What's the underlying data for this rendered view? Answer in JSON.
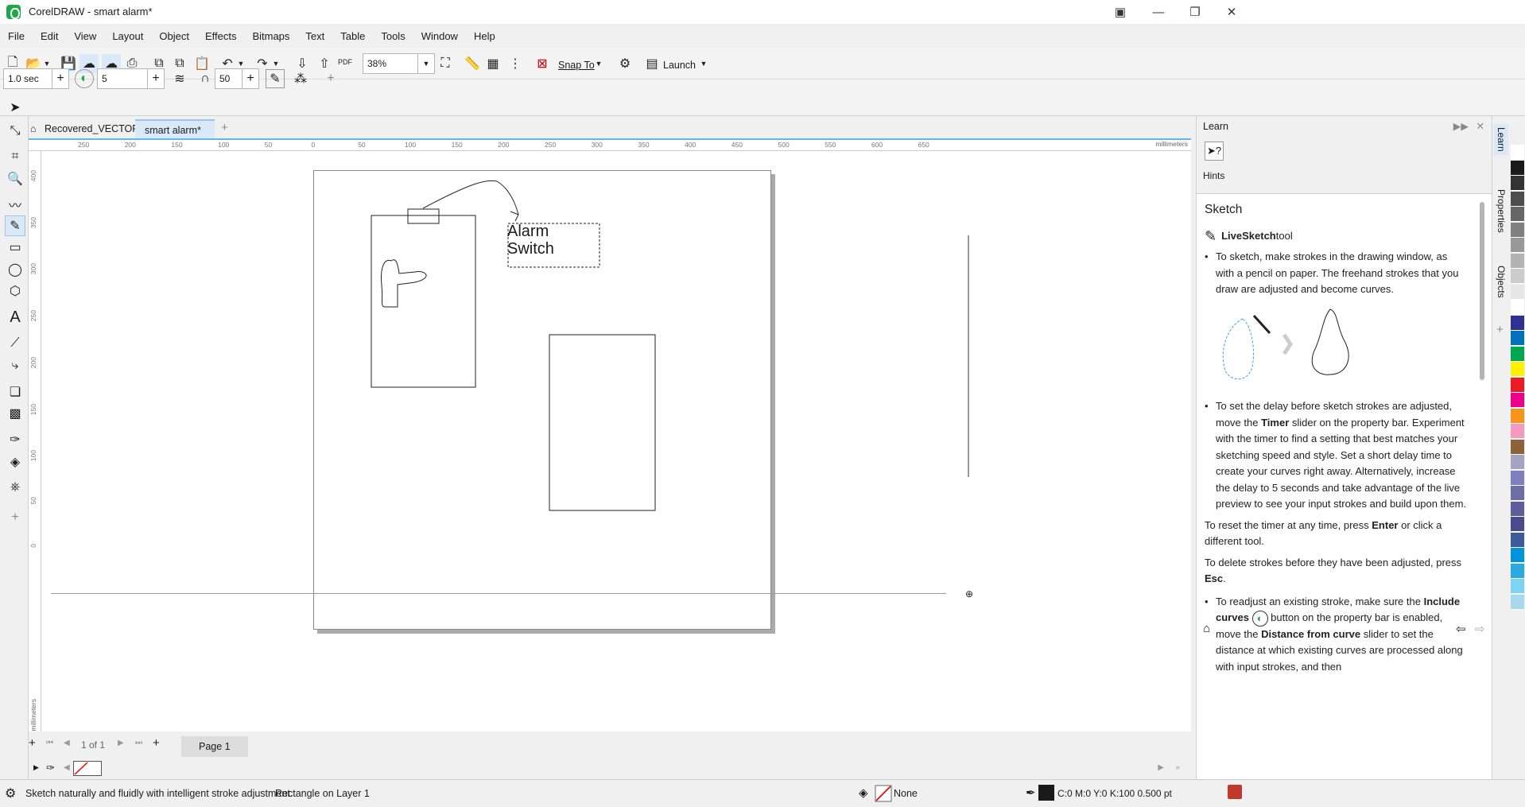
{
  "window": {
    "title": "CorelDRAW - smart alarm*"
  },
  "menu": [
    "File",
    "Edit",
    "View",
    "Layout",
    "Object",
    "Effects",
    "Bitmaps",
    "Text",
    "Table",
    "Tools",
    "Window",
    "Help"
  ],
  "toolbar": {
    "zoom": "38%",
    "snap_to": "Snap To",
    "launch": "Launch",
    "pdf": "PDF"
  },
  "propertybar": {
    "timer": "1.0 sec",
    "include_curves": "5",
    "distance": "50"
  },
  "tabs": [
    {
      "label": "Recovered_VECTOR*"
    },
    {
      "label": "smart alarm*"
    }
  ],
  "ruler": {
    "unit": "millimeters",
    "h_ticks": [
      "250",
      "200",
      "150",
      "100",
      "50",
      "0",
      "50",
      "100",
      "150",
      "200",
      "250",
      "300",
      "350",
      "400",
      "450",
      "500",
      "550",
      "600",
      "650"
    ],
    "v_ticks": [
      "400",
      "350",
      "300",
      "250",
      "200",
      "150",
      "100",
      "50",
      "0"
    ]
  },
  "canvas": {
    "textbox": [
      "Alarm",
      "Switch"
    ]
  },
  "pagenav": {
    "counter": "1 of 1",
    "page_tab": "Page 1"
  },
  "status": {
    "hint": "Sketch naturally and fluidly with intelligent stroke adjustment.",
    "selection": "Rectangle on Layer 1",
    "fill": "None",
    "outline": "C:0 M:0 Y:0 K:100  0.500 pt"
  },
  "learn": {
    "header": "Learn",
    "hints_label": "Hints",
    "section": "Sketch",
    "tool_name": "LiveSketch",
    "tool_suffix": " tool",
    "p1": "To sketch, make strokes in the drawing window, as with a pencil on paper. The freehand strokes that you draw are adjusted and become curves.",
    "p2a": "To set the delay before sketch strokes are adjusted, move the ",
    "p2b": "Timer",
    "p2c": " slider on the property bar. Experiment with the timer to find a setting that best matches your sketching speed and style. Set a short delay time to create your curves right away. Alternatively, increase the delay to 5 seconds and take advantage of the live preview to see your input strokes and build upon them.",
    "p3a": "To reset the timer at any time, press ",
    "p3b": "Enter",
    "p3c": " or click a different tool.",
    "p4a": "To delete strokes before they have been adjusted, press ",
    "p4b": "Esc",
    "p4c": ".",
    "p5a": "To readjust an existing stroke, make sure the ",
    "p5b": "Include curves",
    "p5c": " button on the property bar is enabled, move the ",
    "p5d": "Distance from curve",
    "p5e": " slider to set the distance at which existing curves are processed along with input strokes, and then"
  },
  "sidetabs": [
    "Learn",
    "Properties",
    "Objects"
  ],
  "colors": {
    "accent": "#5fb8e6",
    "selection": "#d9e9f8"
  },
  "palette": [
    "#ffffff",
    "#1a1a1a",
    "#333333",
    "#4d4d4d",
    "#666666",
    "#808080",
    "#999999",
    "#b3b3b3",
    "#cccccc",
    "#e6e6e6",
    "#ffffff",
    "#2e3192",
    "#0071bc",
    "#00a651",
    "#fff200",
    "#ed1c24",
    "#ec008c",
    "#f7941d",
    "#f49ac1",
    "#8c6239",
    "#a3a3c2",
    "#8080c0",
    "#6d6da8",
    "#5e5e9e",
    "#4a4a8c",
    "#3d5a99",
    "#0095da",
    "#29abe2",
    "#7fd3f2",
    "#a7d9ec"
  ]
}
